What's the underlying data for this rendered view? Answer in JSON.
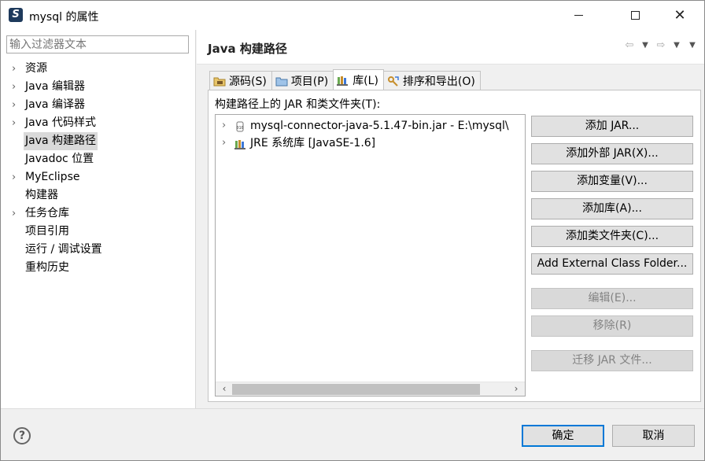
{
  "window": {
    "title": "mysql 的属性",
    "app_icon_glyph": "S"
  },
  "left": {
    "filter_placeholder": "输入过滤器文本",
    "items": [
      {
        "label": "资源",
        "expandable": true
      },
      {
        "label": "Java 编辑器",
        "expandable": true
      },
      {
        "label": "Java 编译器",
        "expandable": true
      },
      {
        "label": "Java 代码样式",
        "expandable": true
      },
      {
        "label": "Java 构建路径",
        "expandable": false,
        "selected": true
      },
      {
        "label": "Javadoc 位置",
        "expandable": false
      },
      {
        "label": "MyEclipse",
        "expandable": true
      },
      {
        "label": "构建器",
        "expandable": false
      },
      {
        "label": "任务仓库",
        "expandable": true
      },
      {
        "label": "项目引用",
        "expandable": false
      },
      {
        "label": "运行 / 调试设置",
        "expandable": false
      },
      {
        "label": "重构历史",
        "expandable": false
      }
    ]
  },
  "page": {
    "title": "Java 构建路径",
    "tabs": [
      {
        "label": "源码(S)",
        "icon": "source-folder-icon"
      },
      {
        "label": "项目(P)",
        "icon": "project-icon"
      },
      {
        "label": "库(L)",
        "icon": "library-icon",
        "active": true
      },
      {
        "label": "排序和导出(O)",
        "icon": "order-export-icon"
      }
    ],
    "tree_caption": "构建路径上的 JAR 和类文件夹(T):",
    "tree": [
      {
        "label": "mysql-connector-java-5.1.47-bin.jar  -  E:\\mysql\\",
        "icon": "jar-icon"
      },
      {
        "label": "JRE 系统库 [JavaSE-1.6]",
        "icon": "library-icon"
      }
    ],
    "buttons": [
      {
        "label": "添加 JAR...",
        "enabled": true
      },
      {
        "label": "添加外部 JAR(X)...",
        "enabled": true
      },
      {
        "label": "添加变量(V)...",
        "enabled": true
      },
      {
        "label": "添加库(A)...",
        "enabled": true
      },
      {
        "label": "添加类文件夹(C)...",
        "enabled": true
      },
      {
        "label": "Add External Class Folder...",
        "enabled": true
      },
      {
        "label": "编辑(E)...",
        "enabled": false
      },
      {
        "label": "移除(R)",
        "enabled": false
      },
      {
        "label": "迁移 JAR 文件...",
        "enabled": false
      }
    ]
  },
  "footer": {
    "help_glyph": "?",
    "ok_label": "确定",
    "cancel_label": "取消"
  },
  "colors": {
    "accent": "#0078d7",
    "selection": "#d9d9d9",
    "button_bg": "#e1e1e1"
  }
}
